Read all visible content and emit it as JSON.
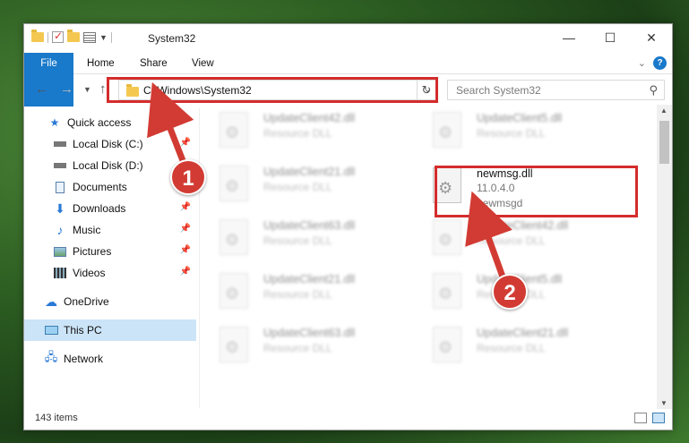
{
  "window": {
    "title": "System32",
    "controls": {
      "minimize": "—",
      "maximize": "☐",
      "close": "✕"
    }
  },
  "ribbon": {
    "tabs": [
      "File",
      "Home",
      "Share",
      "View"
    ]
  },
  "address": {
    "path": "C:\\Windows\\System32",
    "search_placeholder": "Search System32"
  },
  "sidebar": {
    "items": [
      {
        "label": "Quick access",
        "icon": "star-icon"
      },
      {
        "label": "Local Disk (C:)",
        "icon": "drive-icon",
        "pinned": true
      },
      {
        "label": "Local Disk (D:)",
        "icon": "drive-icon"
      },
      {
        "label": "Documents",
        "icon": "documents-icon",
        "pinned": true
      },
      {
        "label": "Downloads",
        "icon": "download-icon",
        "pinned": true
      },
      {
        "label": "Music",
        "icon": "music-icon",
        "pinned": true
      },
      {
        "label": "Pictures",
        "icon": "pictures-icon",
        "pinned": true
      },
      {
        "label": "Videos",
        "icon": "videos-icon",
        "pinned": true
      },
      {
        "label": "OneDrive",
        "icon": "cloud-icon"
      },
      {
        "label": "This PC",
        "icon": "pc-icon",
        "selected": true
      },
      {
        "label": "Network",
        "icon": "network-icon"
      }
    ]
  },
  "files": {
    "left": [
      {
        "name": "UpdateClient42.dll",
        "desc": "Resource DLL"
      },
      {
        "name": "UpdateClient21.dll",
        "desc": "Resource DLL"
      },
      {
        "name": "UpdateClient63.dll",
        "desc": "Resource DLL"
      },
      {
        "name": "UpdateClient21.dll",
        "desc": "Resource DLL"
      },
      {
        "name": "UpdateClient63.dll",
        "desc": "Resource DLL"
      }
    ],
    "right": [
      {
        "name": "UpdateClient5.dll",
        "desc": "Resource DLL"
      },
      {
        "name": "UpdateClient42.dll",
        "desc": "Resource DLL"
      },
      {
        "name": "UpdateClient5.dll",
        "desc": "Resource DLL"
      },
      {
        "name": "UpdateClient21.dll",
        "desc": "Resource DLL"
      }
    ],
    "target": {
      "name": "newmsg.dll",
      "version": "11.0.4.0",
      "company": "newmsgd"
    }
  },
  "status": {
    "items": "143 items"
  },
  "markers": [
    "1",
    "2"
  ],
  "colors": {
    "accent": "#1979ca",
    "highlight": "#d42c2c",
    "selected": "#cce4f7"
  }
}
